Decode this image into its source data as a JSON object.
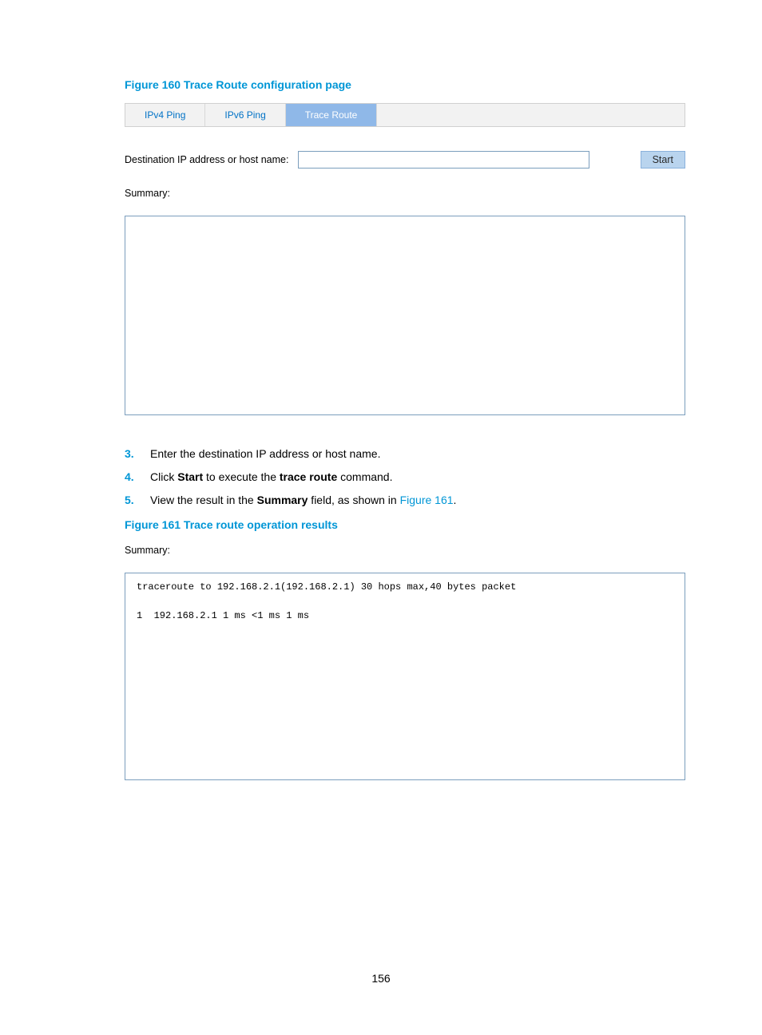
{
  "figure160": {
    "caption": "Figure 160 Trace Route configuration page",
    "tabs": {
      "ipv4": "IPv4 Ping",
      "ipv6": "IPv6 Ping",
      "tracert": "Trace Route"
    },
    "form": {
      "dest_label": "Destination IP address or host name:",
      "dest_value": "",
      "start_label": "Start"
    },
    "summary_label": "Summary:"
  },
  "steps": {
    "s3_num": "3.",
    "s3_text": "Enter the destination IP address or host name.",
    "s4_num": "4.",
    "s4_pre": "Click ",
    "s4_b1": "Start",
    "s4_mid": " to execute the ",
    "s4_b2": "trace route",
    "s4_post": " command.",
    "s5_num": "5.",
    "s5_pre": "View the result in the ",
    "s5_b": "Summary",
    "s5_mid": " field, as shown in ",
    "s5_link": "Figure 161",
    "s5_post": "."
  },
  "figure161": {
    "caption": "Figure 161 Trace route operation results",
    "summary_label": "Summary:",
    "output": "traceroute to 192.168.2.1(192.168.2.1) 30 hops max,40 bytes packet\n\n1  192.168.2.1 1 ms <1 ms 1 ms"
  },
  "page_number": "156"
}
